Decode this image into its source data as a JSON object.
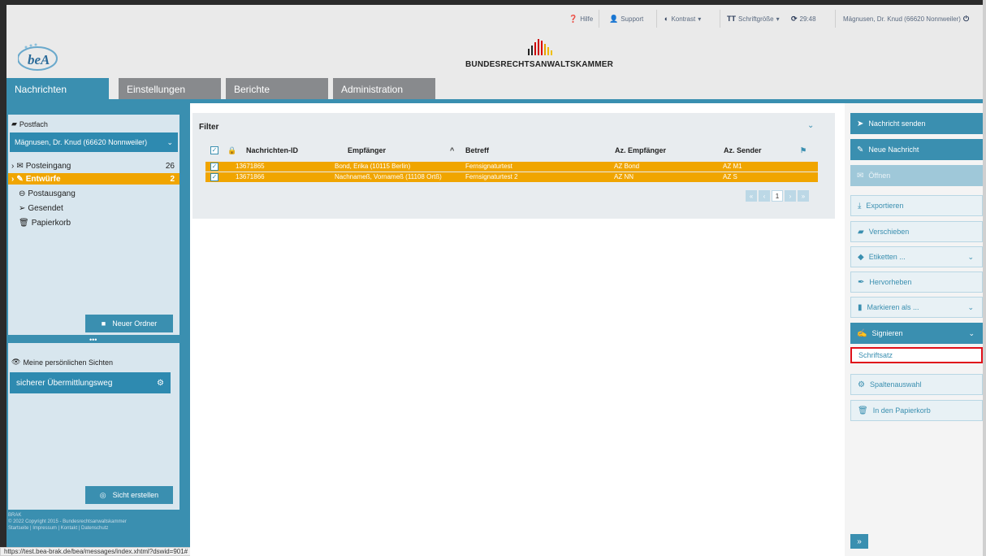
{
  "topbar": {
    "hilfe": "Hilfe",
    "support": "Support",
    "kontrast": "Kontrast",
    "schriftgroesse": "Schriftgröße",
    "timer": "29:48",
    "user": "Mägnusen, Dr. Knud (66620 Nonnweiler)"
  },
  "header": {
    "logo_text": "beA",
    "brand": "BUNDESRECHTSANWALTSKAMMER"
  },
  "nav": {
    "tabs": [
      {
        "label": "Nachrichten"
      },
      {
        "label": "Einstellungen"
      },
      {
        "label": "Berichte"
      },
      {
        "label": "Administration"
      }
    ]
  },
  "sidebar": {
    "postfach_label": "Postfach",
    "account": "Mägnusen, Dr. Knud (66620 Nonnweiler)",
    "folders": [
      {
        "label": "Posteingang",
        "count": "26"
      },
      {
        "label": "Entwürfe",
        "count": "2"
      },
      {
        "label": "Postausgang",
        "count": ""
      },
      {
        "label": "Gesendet",
        "count": ""
      },
      {
        "label": "Papierkorb",
        "count": ""
      }
    ],
    "new_folder_btn": "Neuer Ordner",
    "dots": "•••",
    "sichten_title": "Meine persönlichen Sichten",
    "sicht_item": "sicherer Übermittlungsweg",
    "create_sicht_btn": "Sicht erstellen",
    "footer_line1": "BRAK",
    "footer_line2": "© 2022 Copyright 2015 - Bundesrechtsanwaltskammer",
    "footer_line3": "Startseite | Impressum | Kontakt | Datenschutz"
  },
  "status_url": "https://test.bea-brak.de/bea/messages/index.xhtml?dswid=901#",
  "main": {
    "filter_title": "Filter",
    "columns": {
      "id": "Nachrichten-ID",
      "recipient": "Empfänger",
      "subject": "Betreff",
      "az_recipient": "Az. Empfänger",
      "az_sender": "Az. Sender"
    },
    "rows": [
      {
        "id": "13671865",
        "recipient": "Bond, Erika (10115 Berlin)",
        "subject": "Fernsignaturtest",
        "az_recipient": "AZ Bond",
        "az_sender": "AZ M1"
      },
      {
        "id": "13671866",
        "recipient": "Nachnameß, Vornameß (11108 Ortß)",
        "subject": "Fernsignaturtest 2",
        "az_recipient": "AZ NN",
        "az_sender": "AZ S"
      }
    ],
    "pager": {
      "first": "«",
      "prev": "‹",
      "current": "1",
      "next": "›",
      "last": "»"
    }
  },
  "actions": {
    "send": "Nachricht senden",
    "new": "Neue Nachricht",
    "open": "Öffnen",
    "export": "Exportieren",
    "move": "Verschieben",
    "labels": "Etiketten ...",
    "highlight": "Hervorheben",
    "mark_as": "Markieren als ...",
    "sign": "Signieren",
    "schriftsatz": "Schriftsatz",
    "columns": "Spaltenauswahl",
    "trash": "In den Papierkorb",
    "expand": "»"
  },
  "colors": {
    "accent": "#3a8fb0",
    "selected_row": "#f0a500",
    "highlight_outline": "#e0101a"
  }
}
